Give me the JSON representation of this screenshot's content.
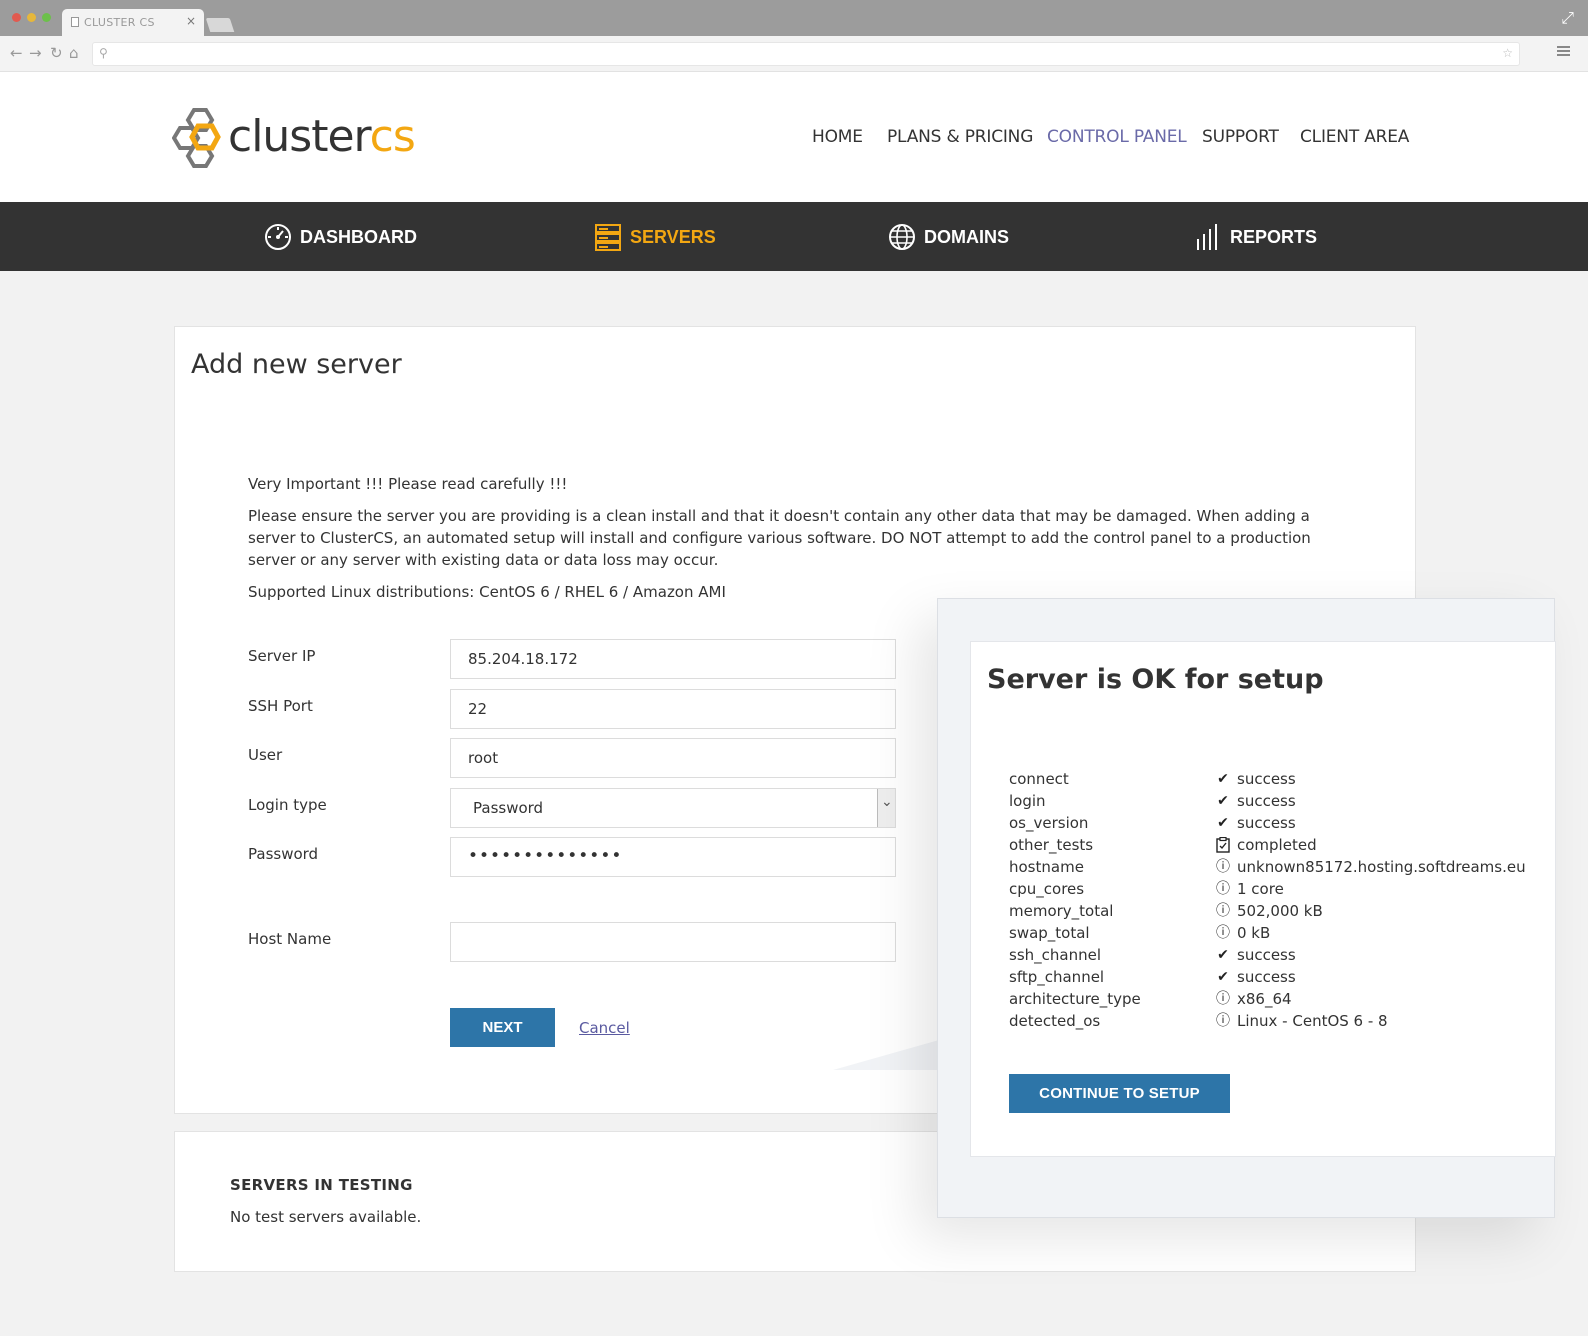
{
  "browser": {
    "tab_title": "CLUSTER CS",
    "tab_close": "×"
  },
  "header": {
    "logo_word": "cluster",
    "logo_accent": "cs",
    "nav": [
      {
        "label": "HOME"
      },
      {
        "label": "PLANS & PRICING"
      },
      {
        "label": "CONTROL PANEL"
      },
      {
        "label": "SUPPORT"
      },
      {
        "label": "CLIENT AREA"
      }
    ]
  },
  "mainnav": {
    "items": [
      {
        "label": "DASHBOARD",
        "icon": "dashboard-icon"
      },
      {
        "label": "SERVERS",
        "icon": "servers-icon"
      },
      {
        "label": "DOMAINS",
        "icon": "globe-icon"
      },
      {
        "label": "REPORTS",
        "icon": "bar-chart-icon"
      }
    ],
    "active_color": "#f3a712"
  },
  "page": {
    "title": "Add new server",
    "notice_heading": "Very Important !!! Please read carefully !!!",
    "notice_body": "Please ensure the server you are providing is a clean install and that it doesn't contain any other data that may be damaged. When adding a server to ClusterCS, an automated setup will install and configure various software. DO NOT attempt to add the control panel to a production server or any server with existing data or data loss may occur.",
    "supported": "Supported Linux distributions: CentOS 6 / RHEL 6 / Amazon AMI"
  },
  "form": {
    "server_ip_label": "Server IP",
    "server_ip_value": "85.204.18.172",
    "ssh_port_label": "SSH Port",
    "ssh_port_value": "22",
    "user_label": "User",
    "user_value": "root",
    "login_type_label": "Login type",
    "login_type_value": "Password",
    "password_label": "Password",
    "password_value": "••••••••••••••",
    "host_name_label": "Host Name",
    "host_name_value": "",
    "next_label": "NEXT",
    "cancel_label": "Cancel"
  },
  "testing": {
    "title": "SERVERS IN TESTING",
    "empty_text": "No test servers available."
  },
  "popup": {
    "title": "Server is OK for setup",
    "checks": [
      {
        "key": "connect",
        "icon": "check-icon",
        "value": "success"
      },
      {
        "key": "login",
        "icon": "check-icon",
        "value": "success"
      },
      {
        "key": "os_version",
        "icon": "check-icon",
        "value": "success"
      },
      {
        "key": "other_tests",
        "icon": "clipboard-check-icon",
        "value": "completed"
      },
      {
        "key": "hostname",
        "icon": "info-icon",
        "value": "unknown85172.hosting.softdreams.eu"
      },
      {
        "key": "cpu_cores",
        "icon": "info-icon",
        "value": "1 core"
      },
      {
        "key": "memory_total",
        "icon": "info-icon",
        "value": "502,000 kB"
      },
      {
        "key": "swap_total",
        "icon": "info-icon",
        "value": "0 kB"
      },
      {
        "key": "ssh_channel",
        "icon": "check-icon",
        "value": "success"
      },
      {
        "key": "sftp_channel",
        "icon": "check-icon",
        "value": "success"
      },
      {
        "key": "architecture_type",
        "icon": "info-icon",
        "value": "x86_64"
      },
      {
        "key": "detected_os",
        "icon": "info-icon",
        "value": "Linux - CentOS 6 - 8"
      }
    ],
    "continue_label": "CONTINUE TO SETUP"
  },
  "colors": {
    "brand_orange": "#f3a712",
    "button_blue": "#2d75a8",
    "dark_bar": "#333333",
    "link_purple": "#5a5aa0"
  }
}
